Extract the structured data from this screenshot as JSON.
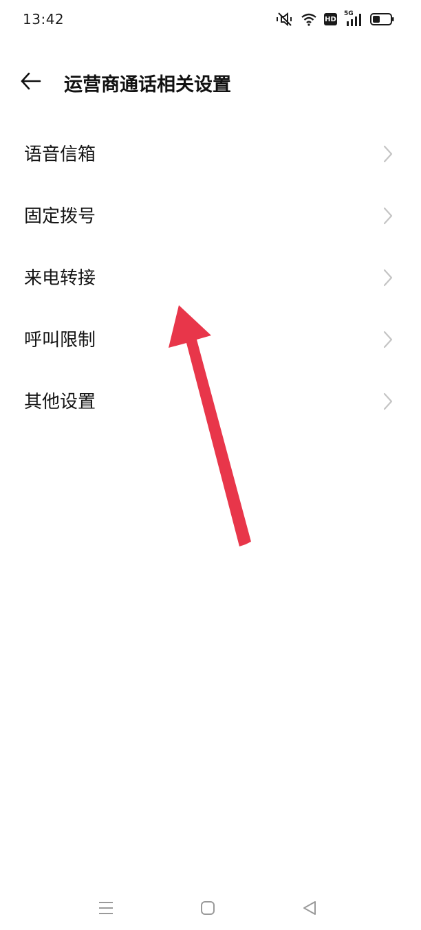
{
  "status_bar": {
    "time": "13:42",
    "hd_label": "HD",
    "network_label": "5G",
    "icons": [
      "mute-icon",
      "wifi-icon",
      "hd-icon",
      "signal-icon",
      "battery-icon"
    ]
  },
  "header": {
    "title": "运营商通话相关设置",
    "back_icon": "arrow-left-icon"
  },
  "menu": {
    "items": [
      {
        "label": "语音信箱"
      },
      {
        "label": "固定拨号"
      },
      {
        "label": "来电转接"
      },
      {
        "label": "呼叫限制"
      },
      {
        "label": "其他设置"
      }
    ]
  },
  "annotation": {
    "color": "#e8364a",
    "icon": "annotation-arrow-icon"
  },
  "nav_bar": {
    "icons": [
      "menu-icon",
      "home-icon",
      "back-triangle-icon"
    ]
  },
  "colors": {
    "background": "#ffffff",
    "text": "#151515",
    "chevron": "#c4c4c4"
  }
}
